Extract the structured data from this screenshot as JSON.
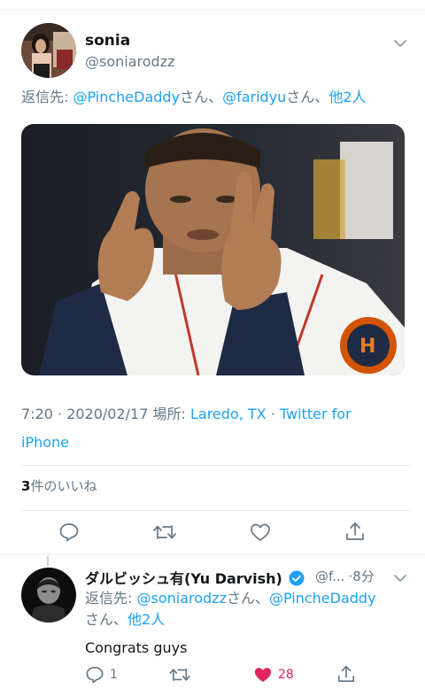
{
  "tweet": {
    "name": "sonia",
    "handle": "@soniarodzz",
    "reply_prefix": "返信先: ",
    "reply_user1": "@PincheDaddy",
    "reply_san1": "さん、",
    "reply_user2": "@faridyu",
    "reply_san2": "さん、",
    "reply_others": "他2人",
    "time": "7:20 · 2020/02/17 場所: ",
    "location": "Laredo, TX",
    "via_sep": " · ",
    "source": "Twitter for iPhone",
    "likes_count": "3",
    "likes_label": "件のいいね"
  },
  "reply": {
    "name": "ダルビッシュ有(Yu Darvish)",
    "handle": "@f...",
    "time": "·8分",
    "reply_prefix": "返信先: ",
    "reply_user1": "@soniarodzz",
    "reply_san1": "さん、",
    "reply_user2": "@PincheDaddy",
    "reply_san2": "さん、",
    "reply_others": "他2人",
    "text": "Congrats guys",
    "reply_count": "1",
    "like_count": "28"
  },
  "colors": {
    "accent": "#1da1f2",
    "like_red": "#e0245e",
    "muted": "#657786"
  }
}
